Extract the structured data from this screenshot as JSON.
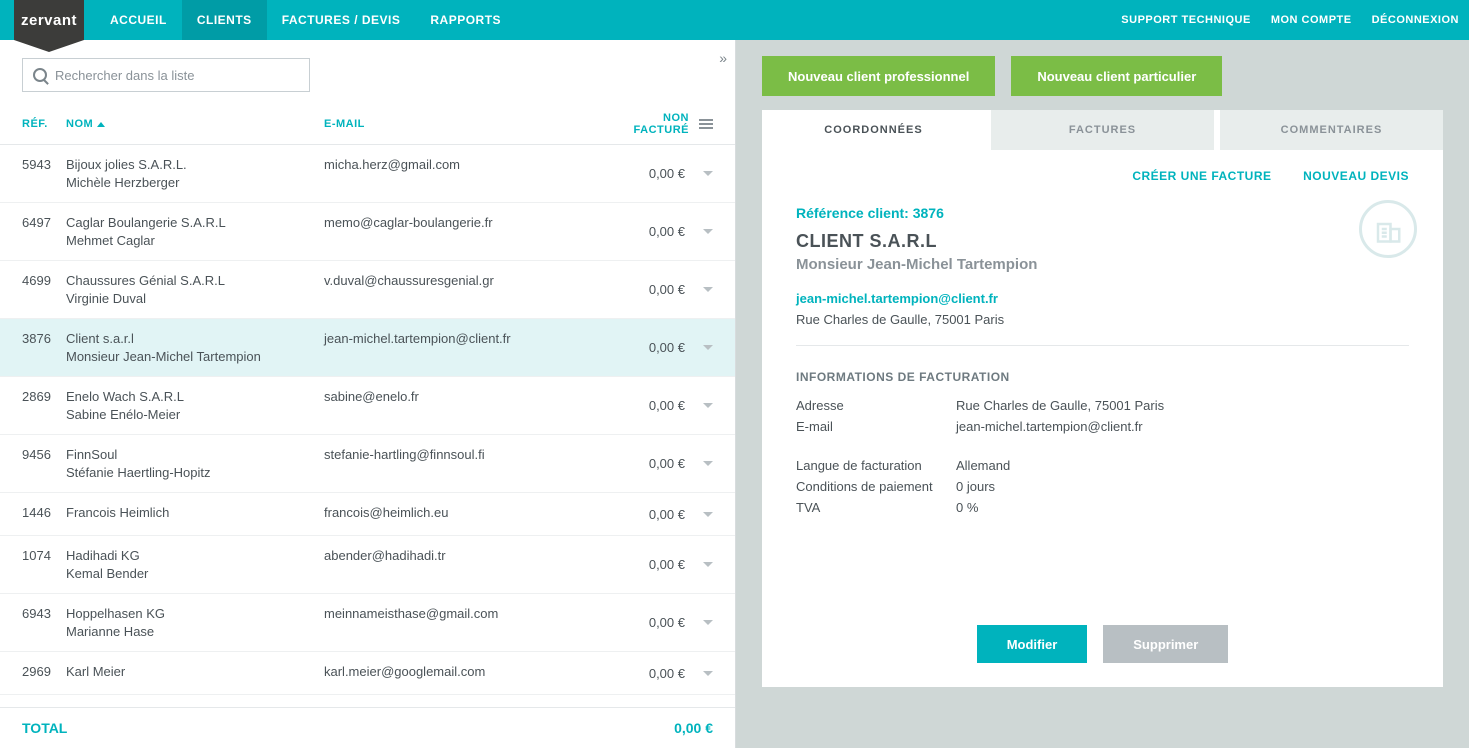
{
  "brand": "zervant",
  "nav": {
    "accueil": "ACCUEIL",
    "clients": "CLIENTS",
    "factures": "FACTURES / DEVIS",
    "rapports": "RAPPORTS",
    "support": "SUPPORT TECHNIQUE",
    "compte": "MON COMPTE",
    "deconnexion": "DÉCONNEXION"
  },
  "search": {
    "placeholder": "Rechercher dans la liste"
  },
  "columns": {
    "ref": "RÉF.",
    "nom": "NOM",
    "email": "E-MAIL",
    "nonFacture": "NON FACTURÉ"
  },
  "clients": [
    {
      "ref": "5943",
      "name": "Bijoux jolies S.A.R.L.",
      "contact": "Michèle Herzberger",
      "email": "micha.herz@gmail.com",
      "amount": "0,00 €",
      "selected": false
    },
    {
      "ref": "6497",
      "name": "Caglar Boulangerie S.A.R.L",
      "contact": "Mehmet Caglar",
      "email": "memo@caglar-boulangerie.fr",
      "amount": "0,00 €",
      "selected": false
    },
    {
      "ref": "4699",
      "name": "Chaussures Génial S.A.R.L",
      "contact": "Virginie Duval",
      "email": "v.duval@chaussuresgenial.gr",
      "amount": "0,00 €",
      "selected": false
    },
    {
      "ref": "3876",
      "name": "Client s.a.r.l",
      "contact": "Monsieur Jean-Michel Tartempion",
      "email": "jean-michel.tartempion@client.fr",
      "amount": "0,00 €",
      "selected": true
    },
    {
      "ref": "2869",
      "name": "Enelo Wach S.A.R.L",
      "contact": "Sabine Enélo-Meier",
      "email": "sabine@enelo.fr",
      "amount": "0,00 €",
      "selected": false
    },
    {
      "ref": "9456",
      "name": "FinnSoul",
      "contact": "Stéfanie Haertling-Hopitz",
      "email": "stefanie-hartling@finnsoul.fi",
      "amount": "0,00 €",
      "selected": false
    },
    {
      "ref": "1446",
      "name": "Francois Heimlich",
      "contact": "",
      "email": "francois@heimlich.eu",
      "amount": "0,00 €",
      "selected": false
    },
    {
      "ref": "1074",
      "name": "Hadihadi KG",
      "contact": "Kemal Bender",
      "email": "abender@hadihadi.tr",
      "amount": "0,00 €",
      "selected": false
    },
    {
      "ref": "6943",
      "name": "Hoppelhasen KG",
      "contact": "Marianne Hase",
      "email": "meinnameisthase@gmail.com",
      "amount": "0,00 €",
      "selected": false
    },
    {
      "ref": "2969",
      "name": "Karl Meier",
      "contact": "",
      "email": "karl.meier@googlemail.com",
      "amount": "0,00 €",
      "selected": false
    }
  ],
  "total": {
    "label": "TOTAL",
    "value": "0,00 €"
  },
  "actions": {
    "newPro": "Nouveau client professionnel",
    "newPart": "Nouveau client particulier"
  },
  "tabs": {
    "coord": "COORDONNÉES",
    "factures": "FACTURES",
    "comments": "COMMENTAIRES"
  },
  "panelActions": {
    "invoice": "CRÉER UNE FACTURE",
    "quote": "NOUVEAU DEVIS"
  },
  "detail": {
    "refLabel": "Référence client: 3876",
    "name": "CLIENT S.A.R.L",
    "contact": "Monsieur Jean-Michel Tartempion",
    "email": "jean-michel.tartempion@client.fr",
    "address": "Rue Charles de Gaulle, 75001 Paris",
    "billingTitle": "INFORMATIONS DE FACTURATION",
    "rows": {
      "addrLabel": "Adresse",
      "addrVal": "Rue Charles de Gaulle, 75001 Paris",
      "emailLabel": "E-mail",
      "emailVal": "jean-michel.tartempion@client.fr",
      "langLabel": "Langue de facturation",
      "langVal": "Allemand",
      "termsLabel": "Conditions de paiement",
      "termsVal": "0 jours",
      "vatLabel": "TVA",
      "vatVal": "0 %"
    },
    "modify": "Modifier",
    "delete": "Supprimer"
  }
}
